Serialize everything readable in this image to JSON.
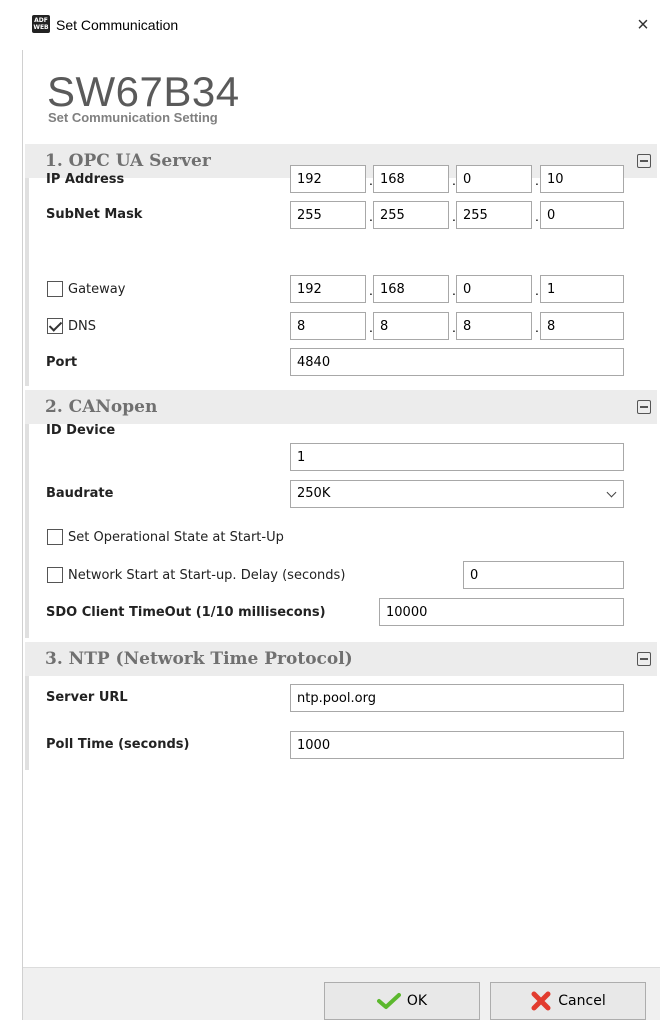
{
  "window": {
    "title": "Set Communication",
    "icon": "app-icon",
    "icon_text": "ADF WEB",
    "close_glyph": "×"
  },
  "header": {
    "app_name": "SW67B34",
    "subtitle": "Set Communication Setting"
  },
  "sections": {
    "opc": {
      "title": "1. OPC UA Server",
      "ip_label": "IP Address",
      "ip": [
        "192",
        "168",
        "0",
        "10"
      ],
      "mask_label": "SubNet Mask",
      "mask": [
        "255",
        "255",
        "255",
        "0"
      ],
      "gateway_label": "Gateway",
      "gateway_checked": false,
      "gateway": [
        "192",
        "168",
        "0",
        "1"
      ],
      "dns_label": "DNS",
      "dns_checked": true,
      "dns": [
        "8",
        "8",
        "8",
        "8"
      ],
      "port_label": "Port",
      "port": "4840"
    },
    "canopen": {
      "title": "2. CANopen",
      "id_label": "ID Device",
      "id_value": "1",
      "baud_label": "Baudrate",
      "baud_value": "250K",
      "op_state_label": "Set Operational State at Start-Up",
      "op_state_checked": false,
      "net_start_label": "Network Start at Start-up. Delay (seconds)",
      "net_start_checked": false,
      "net_start_value": "0",
      "sdo_label": "SDO Client TimeOut (1/10 millisecons)",
      "sdo_value": "10000"
    },
    "ntp": {
      "title": "3. NTP (Network Time Protocol)",
      "server_label": "Server URL",
      "server_value": "ntp.pool.org",
      "poll_label": "Poll Time (seconds)",
      "poll_value": "1000"
    }
  },
  "buttons": {
    "ok_label": "OK",
    "cancel_label": "Cancel"
  },
  "colors": {
    "ok_check": "#5cb82e",
    "cancel_x": "#e23b2e",
    "section_bg": "#ececec"
  }
}
